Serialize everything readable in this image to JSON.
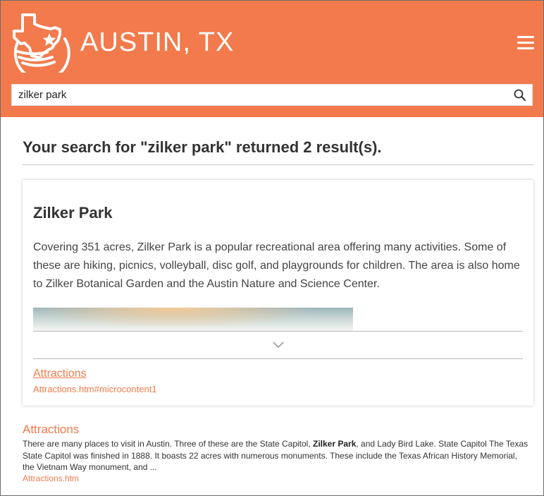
{
  "header": {
    "site_title": "AUSTIN, TX",
    "background_color": "#f27a4c",
    "logo_icon": "texas-state-star-logo",
    "menu_icon": "hamburger-menu-icon"
  },
  "search": {
    "value": "zilker park",
    "icon": "search-icon"
  },
  "results": {
    "heading": "Your search for \"zilker park\" returned 2 result(s)."
  },
  "card": {
    "title": "Zilker Park",
    "description": "Covering 351 acres, Zilker Park is a popular recreational area offering many activities. Some of these are hiking, picnics, volleyball, disc golf, and playgrounds for children. The area is also home to Zilker Botanical Garden and the Austin Nature and Science Center.",
    "expand_icon": "chevron-down-icon",
    "link_label": "Attractions",
    "link_url": "Attractions.htm#microcontent1"
  },
  "result2": {
    "title": "Attractions",
    "snippet_before": "There are many places to visit in Austin. Three of these are the State Capitol, ",
    "snippet_highlight": "Zilker Park",
    "snippet_after": ", and Lady Bird Lake. State Capitol The Texas State Capitol was finished in 1888. It boasts 22 acres with numerous monuments. These include the Texas African History Memorial, the Vietnam Way monument, and ...",
    "url": "Attractions.htm"
  },
  "colors": {
    "accent": "#f27a4c",
    "text": "#333333"
  }
}
